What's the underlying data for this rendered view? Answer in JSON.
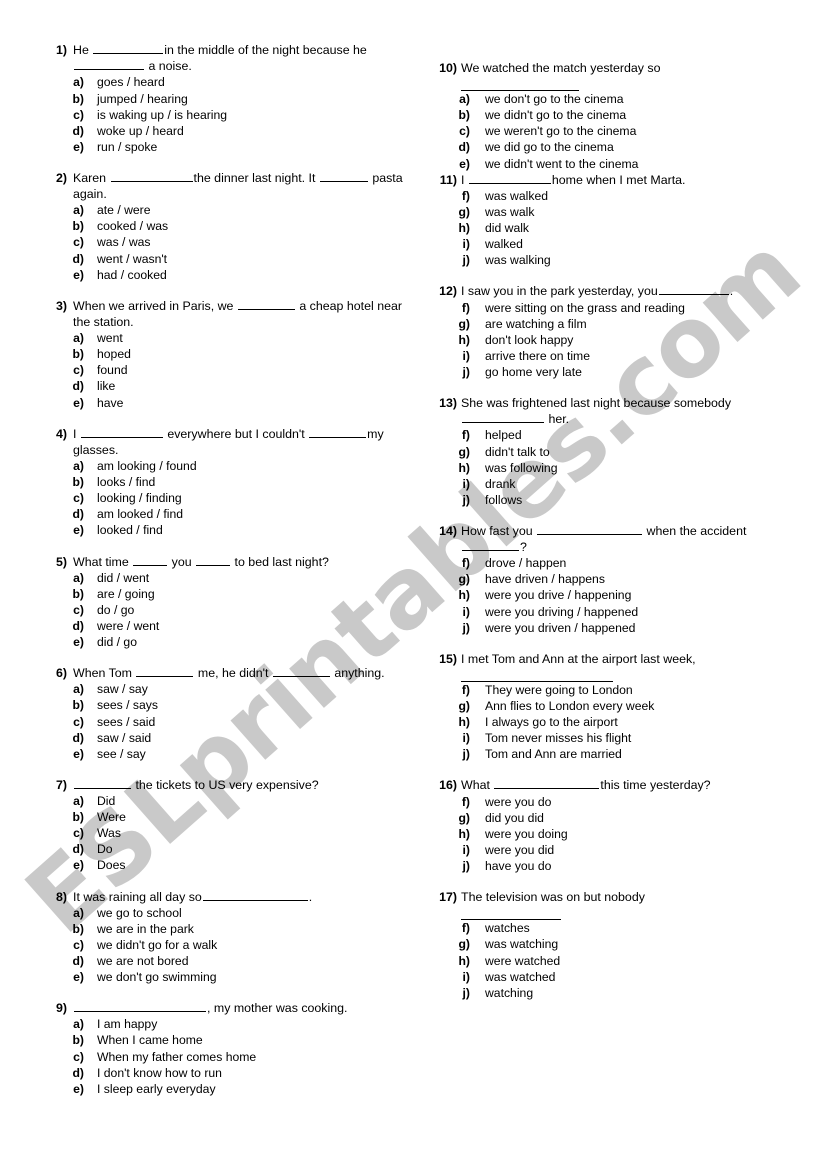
{
  "watermark": {
    "text": "ESLprintables.com",
    "color": "#c9c9c9"
  },
  "page": {
    "background": "#ffffff",
    "text_color": "#000000"
  },
  "columns": [
    {
      "id": "left",
      "questions": [
        {
          "number": "1)",
          "stem_part1": "He ",
          "stem_part2": "in the middle of the night because he ",
          "stem_part3": " a noise.",
          "options": [
            {
              "letter": "a)",
              "text": "goes / heard"
            },
            {
              "letter": "b)",
              "text": "jumped / hearing"
            },
            {
              "letter": "c)",
              "text": "is waking up / is hearing"
            },
            {
              "letter": "d)",
              "text": "woke up / heard"
            },
            {
              "letter": "e)",
              "text": "run / spoke"
            }
          ]
        },
        {
          "number": "2)",
          "stem_part1": "Karen ",
          "stem_part2": "the dinner last night. It ",
          "stem_part3": " pasta again.",
          "options": [
            {
              "letter": "a)",
              "text": "ate / were"
            },
            {
              "letter": "b)",
              "text": "cooked / was"
            },
            {
              "letter": "c)",
              "text": "was / was"
            },
            {
              "letter": "d)",
              "text": "went / wasn't"
            },
            {
              "letter": "e)",
              "text": "had / cooked"
            }
          ]
        },
        {
          "number": "3)",
          "stem_part1": "When we arrived in Paris, we ",
          "stem_part2": " a cheap hotel near the station.",
          "options": [
            {
              "letter": "a)",
              "text": "went"
            },
            {
              "letter": "b)",
              "text": "hoped"
            },
            {
              "letter": "c)",
              "text": "found"
            },
            {
              "letter": "d)",
              "text": "like"
            },
            {
              "letter": "e)",
              "text": "have"
            }
          ]
        },
        {
          "number": "4)",
          "stem_part1": "I ",
          "stem_part2": " everywhere but I couldn't ",
          "stem_part3": "my glasses.",
          "options": [
            {
              "letter": "a)",
              "text": "am looking / found"
            },
            {
              "letter": "b)",
              "text": "looks / find"
            },
            {
              "letter": "c)",
              "text": "looking / finding"
            },
            {
              "letter": "d)",
              "text": "am looked / find"
            },
            {
              "letter": "e)",
              "text": "looked / find"
            }
          ]
        },
        {
          "number": "5)",
          "stem_part1": "What time ",
          "stem_part2": " you ",
          "stem_part3": " to bed last night?",
          "options": [
            {
              "letter": "a)",
              "text": "did / went"
            },
            {
              "letter": "b)",
              "text": "are / going"
            },
            {
              "letter": "c)",
              "text": "do / go"
            },
            {
              "letter": "d)",
              "text": "were / went"
            },
            {
              "letter": "e)",
              "text": "did / go"
            }
          ]
        },
        {
          "number": "6)",
          "stem_part1": "When Tom ",
          "stem_part2": " me, he didn't ",
          "stem_part3": " anything.",
          "options": [
            {
              "letter": "a)",
              "text": "saw / say"
            },
            {
              "letter": "b)",
              "text": "sees / says"
            },
            {
              "letter": "c)",
              "text": "sees / said"
            },
            {
              "letter": "d)",
              "text": "saw / said"
            },
            {
              "letter": "e)",
              "text": "see / say"
            }
          ]
        },
        {
          "number": "7)",
          "stem_part1": "",
          "stem_part2": " the tickets to US very expensive?",
          "options": [
            {
              "letter": "a)",
              "text": "Did"
            },
            {
              "letter": "b)",
              "text": "Were"
            },
            {
              "letter": "c)",
              "text": "Was"
            },
            {
              "letter": "d)",
              "text": "Do"
            },
            {
              "letter": "e)",
              "text": "Does"
            }
          ]
        },
        {
          "number": "8)",
          "stem_part1": "It was raining all day so",
          "stem_part2": ".",
          "options": [
            {
              "letter": "a)",
              "text": "we go to school"
            },
            {
              "letter": "b)",
              "text": "we are in the park"
            },
            {
              "letter": "c)",
              "text": "we didn't go for a walk"
            },
            {
              "letter": "d)",
              "text": "we are not bored"
            },
            {
              "letter": "e)",
              "text": "we don't go swimming"
            }
          ]
        },
        {
          "number": "9)",
          "stem_part1": "",
          "stem_part2": ", my mother was cooking.",
          "options": [
            {
              "letter": "a)",
              "text": "I am happy"
            },
            {
              "letter": "b)",
              "text": "When I came home"
            },
            {
              "letter": "c)",
              "text": "When my father comes home"
            },
            {
              "letter": "d)",
              "text": "I don't know how to run"
            },
            {
              "letter": "e)",
              "text": "I sleep early everyday"
            }
          ]
        }
      ]
    },
    {
      "id": "right",
      "questions": [
        {
          "number": "10)",
          "stem_part1": "We watched the match yesterday so",
          "stem_part2": ".",
          "options": [
            {
              "letter": "a)",
              "text": "we don't go to the cinema"
            },
            {
              "letter": "b)",
              "text": "we didn't go to the cinema"
            },
            {
              "letter": "c)",
              "text": "we weren't go to the cinema"
            },
            {
              "letter": "d)",
              "text": "we did go to the cinema"
            },
            {
              "letter": "e)",
              "text": "we didn't went to the cinema"
            }
          ]
        },
        {
          "number": "11)",
          "stem_part1": "I ",
          "stem_part2": "home when I met Marta.",
          "options": [
            {
              "letter": "f)",
              "text": "was walked"
            },
            {
              "letter": "g)",
              "text": "was walk"
            },
            {
              "letter": "h)",
              "text": "did walk"
            },
            {
              "letter": "i)",
              "text": "walked"
            },
            {
              "letter": "j)",
              "text": "was walking"
            }
          ]
        },
        {
          "number": "12)",
          "stem_part1": "I saw you in the park yesterday, you",
          "stem_part2": ".",
          "options": [
            {
              "letter": "f)",
              "text": "were sitting on the grass and reading"
            },
            {
              "letter": "g)",
              "text": "are watching a film"
            },
            {
              "letter": "h)",
              "text": "don't look happy"
            },
            {
              "letter": "i)",
              "text": "arrive there on time"
            },
            {
              "letter": "j)",
              "text": "go home very late"
            }
          ]
        },
        {
          "number": "13)",
          "stem_part1": "She was frightened last night because somebody",
          "stem_part2": " her.",
          "options": [
            {
              "letter": "f)",
              "text": "helped"
            },
            {
              "letter": "g)",
              "text": "didn't talk to"
            },
            {
              "letter": "h)",
              "text": "was following"
            },
            {
              "letter": "i)",
              "text": "drank"
            },
            {
              "letter": "j)",
              "text": "follows"
            }
          ]
        },
        {
          "number": "14)",
          "stem_part1": "How fast you ",
          "stem_part2": " when the accident ",
          "stem_part3": "?",
          "options": [
            {
              "letter": "f)",
              "text": "drove / happen"
            },
            {
              "letter": "g)",
              "text": "have driven / happens"
            },
            {
              "letter": "h)",
              "text": "were you drive / happening"
            },
            {
              "letter": "i)",
              "text": "were you driving / happened"
            },
            {
              "letter": "j)",
              "text": "were you driven / happened"
            }
          ]
        },
        {
          "number": "15)",
          "stem_part1": "I met Tom and Ann at the airport last week,",
          "stem_part2": ".",
          "options": [
            {
              "letter": "f)",
              "text": "They were going to London"
            },
            {
              "letter": "g)",
              "text": "Ann flies to London every week"
            },
            {
              "letter": "h)",
              "text": "I always go to the airport"
            },
            {
              "letter": "i)",
              "text": "Tom never misses his flight"
            },
            {
              "letter": "j)",
              "text": "Tom and Ann are married"
            }
          ]
        },
        {
          "number": "16)",
          "stem_part1": "What ",
          "stem_part2": "this time yesterday?",
          "options": [
            {
              "letter": "f)",
              "text": "were you do"
            },
            {
              "letter": "g)",
              "text": "did you did"
            },
            {
              "letter": "h)",
              "text": "were you doing"
            },
            {
              "letter": "i)",
              "text": "were you did"
            },
            {
              "letter": "j)",
              "text": "have you do"
            }
          ]
        },
        {
          "number": "17)",
          "stem_part1": "The television was on but nobody",
          "stem_part2": ".",
          "options": [
            {
              "letter": "f)",
              "text": "watches"
            },
            {
              "letter": "g)",
              "text": "was watching"
            },
            {
              "letter": "h)",
              "text": "were watched"
            },
            {
              "letter": "i)",
              "text": "was watched"
            },
            {
              "letter": "j)",
              "text": "watching"
            }
          ]
        }
      ]
    }
  ]
}
